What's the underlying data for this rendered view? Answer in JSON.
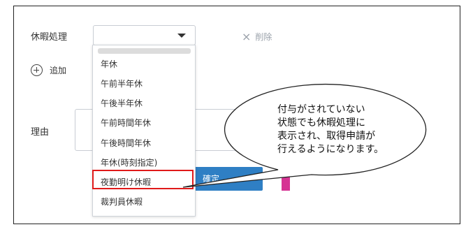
{
  "form": {
    "leave_label": "休暇処理",
    "delete_label": "削除",
    "add_label": "追加",
    "reason_label": "理由",
    "confirm_label": "確定"
  },
  "dropdown": {
    "selected_value": "",
    "options": [
      "年休",
      "午前半年休",
      "午後半年休",
      "午前時間年休",
      "午後時間年休",
      "年休(時刻指定)",
      "夜勤明け休暇",
      "裁判員休暇"
    ],
    "highlighted_option": "夜勤明け休暇"
  },
  "callout": {
    "lines": [
      "付与がされていない",
      "状態でも休暇処理に",
      "表示され、取得申請が",
      "行えるようになります。"
    ]
  },
  "colors": {
    "confirm_button": "#2f7fc4",
    "highlight_border": "#e01a1a",
    "accent_pink": "#d63393"
  }
}
